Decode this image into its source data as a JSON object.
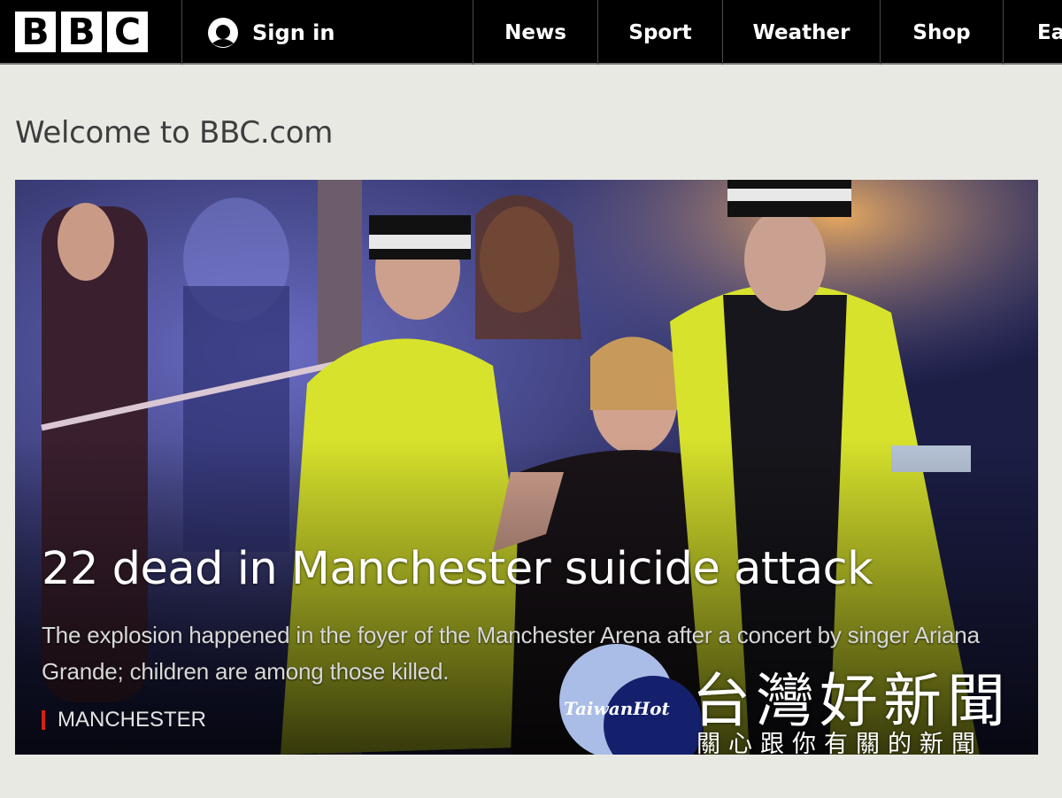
{
  "header": {
    "logo_letters": [
      "B",
      "B",
      "C"
    ],
    "signin_label": "Sign in",
    "nav": [
      "News",
      "Sport",
      "Weather",
      "Shop",
      "Ea"
    ]
  },
  "page": {
    "welcome": "Welcome to BBC.com"
  },
  "hero": {
    "headline": "22 dead in Manchester suicide attack",
    "summary": "The explosion happened in the foyer of the Manchester Arena after a concert by singer Ariana Grande; children are among those killed.",
    "tag": "MANCHESTER",
    "tag_color": "#d91f16"
  },
  "watermark": {
    "brand": "TaiwanHot",
    "title": "台灣好新聞",
    "subtitle": "關心跟你有關的新聞"
  },
  "colors": {
    "topbar": "#000000",
    "page_background": "#e9e9e4",
    "hero_yellow": "#d7e22c"
  }
}
